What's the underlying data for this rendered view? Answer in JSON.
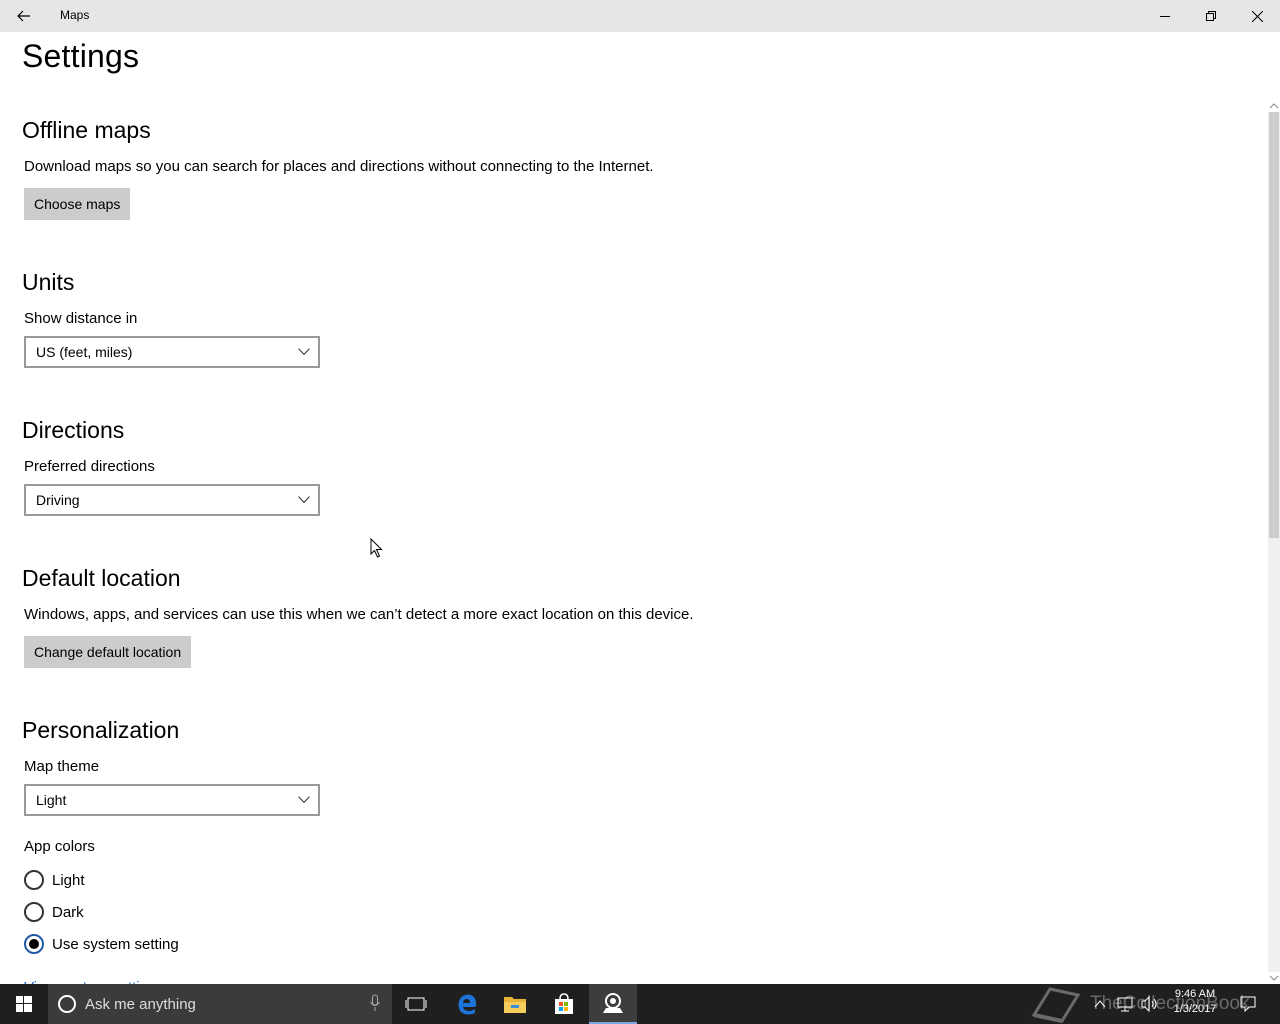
{
  "window": {
    "title": "Maps",
    "back_icon": "arrow-left-icon",
    "controls": [
      "minimize-icon",
      "restore-icon",
      "close-icon"
    ]
  },
  "page": {
    "title": "Settings"
  },
  "offline_maps": {
    "title": "Offline maps",
    "description": "Download maps so you can search for places and directions without connecting to the Internet.",
    "button_label": "Choose maps"
  },
  "units": {
    "title": "Units",
    "field_label": "Show distance in",
    "selected": "US (feet, miles)"
  },
  "directions": {
    "title": "Directions",
    "field_label": "Preferred directions",
    "selected": "Driving"
  },
  "default_location": {
    "title": "Default location",
    "description": "Windows, apps, and services can use this when we can’t detect a more exact location on this device.",
    "button_label": "Change default location"
  },
  "personalization": {
    "title": "Personalization",
    "theme_label": "Map theme",
    "theme_selected": "Light",
    "app_colors_label": "App colors",
    "options": [
      {
        "label": "Light",
        "checked": false
      },
      {
        "label": "Dark",
        "checked": false
      },
      {
        "label": "Use system setting",
        "checked": true
      }
    ],
    "link_label": "View system settings"
  },
  "taskbar": {
    "search_placeholder": "Ask me anything",
    "watermark": "TheCollectionBook",
    "time": "9:46 AM",
    "date": "1/3/2017",
    "accent_color": "#7aa7e0"
  },
  "colors": {
    "button_bg": "#cccccc",
    "link": "#1e6ec8",
    "titlebar": "#e6e6e6",
    "taskbar": "#1f1f1f"
  }
}
